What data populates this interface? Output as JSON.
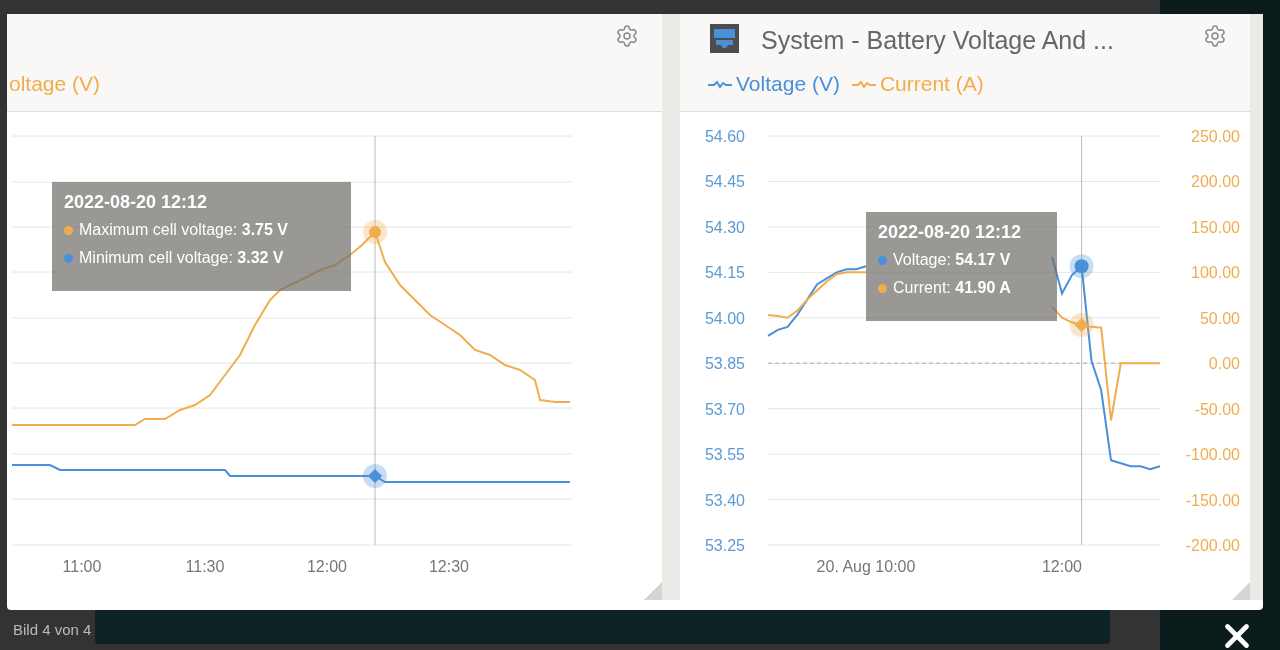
{
  "left_panel": {
    "legend": [
      {
        "label": "oltage (V)",
        "color": "#f0ad4e"
      }
    ],
    "x_ticks": [
      "11:00",
      "11:30",
      "12:00",
      "12:30"
    ],
    "tooltip": {
      "title": "2022-08-20 12:12",
      "rows": [
        {
          "label": "Maximum cell voltage:",
          "value": "3.75 V",
          "color": "#f0ad4e"
        },
        {
          "label": "Minimum cell voltage:",
          "value": "3.32 V",
          "color": "#4a90d9"
        }
      ]
    }
  },
  "right_panel": {
    "title": "System - Battery Voltage And ...",
    "chart_data": {
      "type": "line",
      "categories": [
        null,
        null,
        null,
        null,
        null,
        null,
        null,
        null,
        null,
        null,
        "20. Aug 10:00",
        null,
        null,
        null,
        null,
        null,
        null,
        null,
        null,
        null,
        null,
        null,
        null,
        null,
        null,
        null,
        null,
        null,
        null,
        null,
        "12:00",
        null,
        null,
        null,
        null,
        null,
        null,
        null,
        null,
        null,
        null
      ],
      "ylim": [
        53.25,
        54.6
      ],
      "y2lim": [
        -200,
        250
      ],
      "grid": true,
      "ref_lines": [
        {
          "axis": "y2",
          "value": 0
        }
      ],
      "yticks": [
        {
          "value": 54.6,
          "label": "54.60"
        },
        {
          "value": 54.45,
          "label": "54.45"
        },
        {
          "value": 54.3,
          "label": "54.30"
        },
        {
          "value": 54.15,
          "label": "54.15"
        },
        {
          "value": 54.0,
          "label": "54.00"
        },
        {
          "value": 53.85,
          "label": "53.85"
        },
        {
          "value": 53.7,
          "label": "53.70"
        },
        {
          "value": 53.55,
          "label": "53.55"
        },
        {
          "value": 53.4,
          "label": "53.40"
        },
        {
          "value": 53.25,
          "label": "53.25"
        }
      ],
      "y2ticks": [
        {
          "value": 250,
          "label": "250.00"
        },
        {
          "value": 200,
          "label": "200.00"
        },
        {
          "value": 150,
          "label": "150.00"
        },
        {
          "value": 100,
          "label": "100.00"
        },
        {
          "value": 50,
          "label": "50.00"
        },
        {
          "value": 0,
          "label": "0.00"
        },
        {
          "value": -50,
          "label": "-50.00"
        },
        {
          "value": -100,
          "label": "-100.00"
        },
        {
          "value": -150,
          "label": "-150.00"
        },
        {
          "value": -200,
          "label": "-200.00"
        }
      ],
      "series": [
        {
          "name": "Voltage (V)",
          "color": "#4a90d9",
          "values": [
            53.94,
            53.96,
            53.97,
            54.01,
            54.06,
            54.11,
            54.13,
            54.15,
            54.16,
            54.16,
            54.17,
            null,
            null,
            null,
            null,
            null,
            null,
            null,
            null,
            null,
            null,
            null,
            null,
            null,
            null,
            null,
            null,
            null,
            null,
            54.2,
            54.08,
            54.14,
            54.17,
            53.86,
            53.76,
            53.53,
            53.52,
            53.51,
            53.51,
            53.5,
            53.51
          ]
        },
        {
          "name": "Current (A)",
          "color": "#f0ad4e",
          "axis": "y2",
          "values": [
            53,
            52,
            50,
            58,
            70,
            80,
            90,
            98,
            100,
            100,
            100,
            null,
            null,
            null,
            null,
            null,
            null,
            null,
            null,
            null,
            null,
            null,
            null,
            null,
            null,
            null,
            null,
            null,
            null,
            62,
            50,
            45,
            42,
            40,
            39,
            -63,
            0,
            0,
            0,
            0,
            0
          ]
        }
      ]
    },
    "tooltip": {
      "title": "2022-08-20 12:12",
      "rows": [
        {
          "label": "Voltage:",
          "value": "54.17 V",
          "color": "#4a90d9"
        },
        {
          "label": "Current:",
          "value": "41.90 A",
          "color": "#f0ad4e"
        }
      ]
    }
  },
  "caption": "Bild 4 von 4"
}
